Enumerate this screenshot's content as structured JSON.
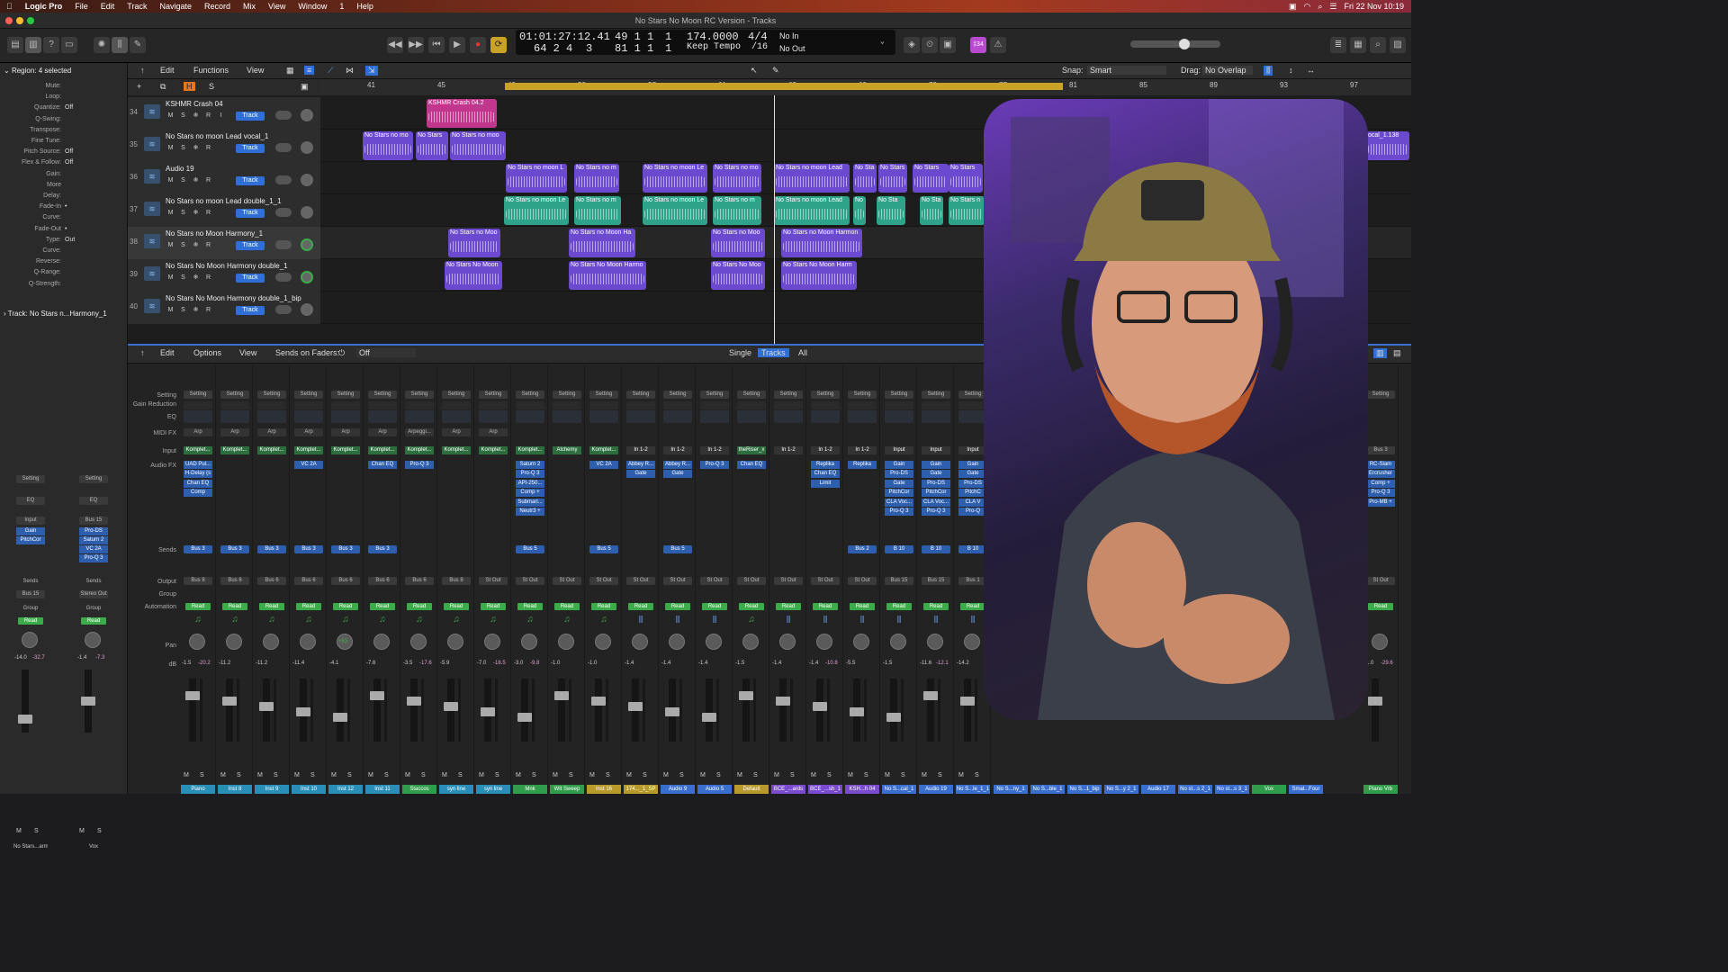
{
  "menubar": {
    "app": "Logic Pro",
    "items": [
      "File",
      "Edit",
      "Track",
      "Navigate",
      "Record",
      "Mix",
      "View",
      "Window",
      "1",
      "Help"
    ],
    "datetime": "Fri 22 Nov 10:19"
  },
  "window": {
    "title": "No Stars No Moon RC Version - Tracks"
  },
  "lcd": {
    "position": "01:01:27:12.41",
    "bars": "64 2 4",
    "sub": "3",
    "bar_a": "49 1 1",
    "bar_a2": "1",
    "bar_b": "81 1 1",
    "bar_b2": "1",
    "tempo": "174.0000",
    "tempo_mode": "Keep Tempo",
    "signature": "4/4",
    "division": "/16",
    "in": "No In",
    "out": "No Out"
  },
  "badge": "‡34",
  "inspector": {
    "region_label": "Region: 4 selected",
    "rows": [
      [
        "Mute:",
        ""
      ],
      [
        "Loop:",
        ""
      ],
      [
        "Quantize:",
        "Off"
      ],
      [
        "Q-Swing:",
        ""
      ],
      [
        "Transpose:",
        ""
      ],
      [
        "Fine Tune:",
        ""
      ],
      [
        "Pitch Source:",
        "Off"
      ],
      [
        "Flex & Follow:",
        "Off"
      ],
      [
        "Gain:",
        ""
      ],
      [
        "More",
        ""
      ],
      [
        "Delay:",
        ""
      ],
      [
        "Fade-In",
        "•"
      ],
      [
        "Curve:",
        ""
      ],
      [
        "Fade-Out",
        "•"
      ],
      [
        "Type:",
        "Out"
      ],
      [
        "Curve:",
        ""
      ],
      [
        "Reverse:",
        ""
      ],
      [
        "Q-Range:",
        ""
      ],
      [
        "Q-Strength:",
        ""
      ]
    ],
    "track_label": "Track:",
    "track_name": "No Stars n...Harmony_1"
  },
  "inspector_strips": [
    {
      "setting": "Setting",
      "eq": "EQ",
      "input": "Input",
      "plugins": [
        "Gain",
        "PitchCor"
      ],
      "sends": "Sends",
      "output": "Bus 15",
      "group": "Group",
      "auto": "Read",
      "pan": "-64",
      "db": "-14.0",
      "db2": "-32.7",
      "name": "No Stars...armony_1"
    },
    {
      "setting": "Setting",
      "eq": "EQ",
      "input": "Bus 15",
      "plugins": [
        "Pro-DS",
        "Saturn 2",
        "VC 2A",
        "Pro-Q 3"
      ],
      "sends": "Sends",
      "output": "Stereo Out",
      "group": "Group",
      "auto": "Read",
      "pan": "",
      "db": "-1.4",
      "db2": "-7.3",
      "name": "Vox"
    }
  ],
  "tracks_toolbar": {
    "edit": "Edit",
    "functions": "Functions",
    "view": "View",
    "snap_label": "Snap:",
    "snap": "Smart",
    "drag_label": "Drag:",
    "drag": "No Overlap"
  },
  "ruler": [
    "41",
    "45",
    "49",
    "53",
    "57",
    "61",
    "65",
    "69",
    "73",
    "77",
    "81",
    "85",
    "89",
    "93",
    "97"
  ],
  "tracks": [
    {
      "num": "34",
      "name": "KSHMR Crash 04",
      "btns": [
        "M",
        "S",
        "❄",
        "R",
        "I"
      ],
      "label": "Track"
    },
    {
      "num": "35",
      "name": "No Stars no moon Lead vocal_1",
      "btns": [
        "M",
        "S",
        "❄",
        "R"
      ],
      "label": "Track"
    },
    {
      "num": "36",
      "name": "Audio 19",
      "btns": [
        "M",
        "S",
        "❄",
        "R"
      ],
      "label": "Track"
    },
    {
      "num": "37",
      "name": "No Stars no moon Lead double_1_1",
      "btns": [
        "M",
        "S",
        "❄",
        "R"
      ],
      "label": "Track"
    },
    {
      "num": "38",
      "name": "No Stars no Moon Harmony_1",
      "btns": [
        "M",
        "S",
        "❄",
        "R"
      ],
      "label": "Track"
    },
    {
      "num": "39",
      "name": "No Stars No Moon Harmony double_1",
      "btns": [
        "M",
        "S",
        "❄",
        "R"
      ],
      "label": "Track"
    },
    {
      "num": "40",
      "name": "No Stars No Moon Harmony double_1_bip",
      "btns": [
        "M",
        "S",
        "❄",
        "R"
      ],
      "label": "Track"
    }
  ],
  "regions": {
    "crash": "KSHMR Crash 04.2",
    "lead": [
      "No Stars no mo",
      "No Stars",
      "No Stars no moo",
      "No Stars no moon L",
      "No Stars no m",
      "No Stars no moon Le",
      "No Stars no mo",
      "No Stars no moon Lead",
      "No Sta",
      "No Stars",
      "No Stars",
      "No Stars"
    ],
    "double": [
      "No Stars no moon Le",
      "No Stars no m",
      "No Stars no moon Le",
      "No Stars no m",
      "No Stars no moon Lead",
      "No",
      "No Sta",
      "No Sta",
      "No Stars n"
    ],
    "harmony": [
      "No Stars no Moo",
      "No Stars no Moon Ha",
      "No Stars no Moo",
      "No Stars no Moon Harmon"
    ],
    "hdouble": [
      "No Stars No Moon",
      "No Stars No Moon Harmo",
      "No Stars No Moo",
      "No Stars No Moon Harm"
    ],
    "right_edge": "ocal_1.138"
  },
  "mixer_toolbar": {
    "edit": "Edit",
    "options": "Options",
    "view": "View",
    "sends_on_faders": "Sends on Faders:",
    "sends_value": "Off",
    "single": "Single",
    "tracks": "Tracks",
    "all": "All"
  },
  "mixer_labels": [
    "Setting",
    "Gain Reduction",
    "EQ",
    "MIDI FX",
    "Input",
    "Audio FX",
    "Sends",
    "Output",
    "Group",
    "Automation",
    "Pan",
    "dB"
  ],
  "strips": [
    {
      "midi": "Arp",
      "input": "Komplet...",
      "plugins": [
        "UAD Pul...",
        "H-Delay (s",
        "Chan EQ",
        "Comp"
      ],
      "send": "Bus 3",
      "output": "Bus 8",
      "db": "-1.5",
      "db2": "-20.2",
      "name": "Piano",
      "color": "#2a8fb8",
      "inst": true
    },
    {
      "midi": "Arp",
      "input": "Komplet...",
      "plugins": [],
      "send": "Bus 3",
      "output": "Bus 6",
      "db": "-11.2",
      "db2": "",
      "name": "Inst 8",
      "color": "#2a8fb8",
      "inst": true
    },
    {
      "midi": "Arp",
      "input": "Komplet...",
      "plugins": [],
      "send": "Bus 3",
      "output": "Bus 6",
      "db": "-11.2",
      "db2": "",
      "name": "Inst 9",
      "color": "#2a8fb8",
      "inst": true
    },
    {
      "midi": "Arp",
      "input": "Komplet...",
      "plugins": [
        "VC 2A"
      ],
      "send": "Bus 3",
      "output": "Bus 6",
      "db": "-11.4",
      "db2": "",
      "name": "Inst 10",
      "color": "#2a8fb8",
      "inst": true
    },
    {
      "midi": "Arp",
      "input": "Komplet...",
      "plugins": [],
      "send": "Bus 3",
      "output": "Bus 6",
      "db": "-4.1",
      "db2": "",
      "name": "Inst 12",
      "color": "#2a8fb8",
      "inst": true,
      "pan": "+63"
    },
    {
      "midi": "Arp",
      "input": "Komplet...",
      "plugins": [
        "Chan EQ"
      ],
      "send": "Bus 3",
      "output": "Bus 6",
      "db": "-7.6",
      "db2": "",
      "name": "Inst 11",
      "color": "#2a8fb8",
      "inst": true
    },
    {
      "midi": "Arpeggi...",
      "input": "Komplet...",
      "plugins": [
        "Pro-Q 3"
      ],
      "send": "",
      "output": "Bus 6",
      "db": "-3.5",
      "db2": "-17.6",
      "name": "Staccos",
      "color": "#2f9d4a",
      "inst": true
    },
    {
      "midi": "Arp",
      "input": "Komplet...",
      "plugins": [],
      "send": "",
      "output": "Bus 8",
      "db": "-5.9",
      "db2": "",
      "name": "syn line",
      "color": "#2a8fb8",
      "inst": true
    },
    {
      "midi": "Arp",
      "input": "Komplet...",
      "plugins": [],
      "send": "",
      "output": "St Out",
      "db": "-7.0",
      "db2": "-16.5",
      "name": "syn line",
      "color": "#2a8fb8",
      "inst": true
    },
    {
      "midi": "",
      "input": "Komplet...",
      "plugins": [
        "Saturn 2",
        "Pro-Q 3",
        "API-250...",
        "Comp +",
        "Submari...",
        "Neutr3 +"
      ],
      "send": "Bus 5",
      "output": "St Out",
      "db": "-3.0",
      "db2": "-9.8",
      "name": "Mnk",
      "color": "#2f9d4a",
      "inst": true
    },
    {
      "midi": "",
      "input": "Alchemy",
      "plugins": [],
      "send": "",
      "output": "St Out",
      "db": "-1.0",
      "db2": "",
      "name": "Wit Sweep",
      "color": "#2f9d4a",
      "inst": true
    },
    {
      "midi": "",
      "input": "Komplet...",
      "plugins": [
        "VC 2A"
      ],
      "send": "Bus 5",
      "output": "St Out",
      "db": "-1.0",
      "db2": "",
      "name": "Inst 16",
      "color": "#b89a2a",
      "inst": true
    },
    {
      "midi": "",
      "input": "In 1-2",
      "plugins": [
        "Abbey R...",
        "Gate"
      ],
      "send": "",
      "output": "St Out",
      "db": "-1.4",
      "db2": "",
      "name": "174..._1_SP",
      "color": "#b89a2a",
      "inst": false
    },
    {
      "midi": "",
      "input": "In 1-2",
      "plugins": [
        "Abbey R...",
        "Gate"
      ],
      "send": "Bus 5",
      "output": "St Out",
      "db": "-1.4",
      "db2": "",
      "name": "Audio 9",
      "color": "#3a6fd0",
      "inst": false
    },
    {
      "midi": "",
      "input": "In 1-2",
      "plugins": [
        "Pro-Q 3"
      ],
      "send": "",
      "output": "St Out",
      "db": "-1.4",
      "db2": "",
      "name": "Audio 5",
      "color": "#3a6fd0",
      "inst": false
    },
    {
      "midi": "",
      "input": "theRiser_x",
      "plugins": [
        "Chan EQ"
      ],
      "send": "",
      "output": "St Out",
      "db": "-1.5",
      "db2": "",
      "name": "Default",
      "color": "#b89a2a",
      "inst": true
    },
    {
      "midi": "",
      "input": "In 1-2",
      "plugins": [],
      "send": "",
      "output": "St Out",
      "db": "-1.4",
      "db2": "",
      "name": "BCE_...ards",
      "color": "#7a4ad0",
      "inst": false
    },
    {
      "midi": "",
      "input": "In 1-2",
      "plugins": [
        "Replika",
        "Chan EQ",
        "Limit"
      ],
      "send": "",
      "output": "St Out",
      "db": "-1.4",
      "db2": "-10.8",
      "name": "BCE_...sh_1",
      "color": "#7a4ad0",
      "inst": false
    },
    {
      "midi": "",
      "input": "In 1-2",
      "plugins": [
        "Replika"
      ],
      "send": "Bus 2",
      "output": "St Out",
      "db": "-5.5",
      "db2": "",
      "name": "KSH...h 04",
      "color": "#7a4ad0",
      "inst": false
    },
    {
      "midi": "",
      "input": "Input",
      "plugins": [
        "Gain",
        "Pro-DS",
        "Gate",
        "PitchCor",
        "CLA Voc...",
        "Pro-Q 3"
      ],
      "send": "B 10",
      "output": "Bus 15",
      "db": "-1.5",
      "db2": "",
      "name": "No S...cal_1",
      "color": "#3a6fd0",
      "inst": false
    },
    {
      "midi": "",
      "input": "Input",
      "plugins": [
        "Gain",
        "Gate",
        "Pro-DS",
        "PitchCor",
        "CLA Voc...",
        "Pro-Q 3"
      ],
      "send": "B 10",
      "output": "Bus 15",
      "db": "-11.6",
      "db2": "-12.1",
      "name": "Audio 19",
      "color": "#3a6fd0",
      "inst": false
    },
    {
      "midi": "",
      "input": "Input",
      "plugins": [
        "Gain",
        "Gate",
        "Pro-DS",
        "PitchC",
        "CLA V",
        "Pro-Q"
      ],
      "send": "B 10",
      "output": "Bus 1",
      "db": "-14.2",
      "db2": "",
      "name": "No S...le_1_1",
      "color": "#3a6fd0",
      "inst": false
    }
  ],
  "right_strips": [
    {
      "input": "Bus 3",
      "plugins": [
        "RC-Slam",
        "Ercrusher",
        "Comp +",
        "Pro-Q 3",
        "Pro-MB +"
      ],
      "output": "St Out",
      "db": "-1.0",
      "db2": "-29.6",
      "name": "Piano Vrb"
    }
  ],
  "bottom_names_tail": [
    "No S...ny_1",
    "No S...ble_1",
    "No S...1_bip",
    "No S...y 2_1",
    "Audio 17",
    "No st...s 2_1",
    "No st...s 3_1",
    "Vox",
    "Smal...Four"
  ],
  "colors": {
    "region_purple": "#6b4ad0",
    "region_teal": "#2fa38a",
    "region_pink": "#c2368e",
    "cycle": "#c9a227",
    "track_blue": "#2f6fd6",
    "read_green": "#3cab4a"
  }
}
